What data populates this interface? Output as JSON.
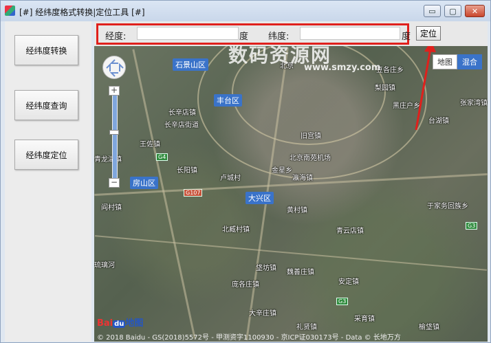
{
  "window": {
    "title": "[#] 经纬度格式转换|定位工具 [#]",
    "buttons": {
      "minimize": "▭",
      "maximize": "▢",
      "close": "✕"
    }
  },
  "sidebar": {
    "items": [
      {
        "label": "经纬度转换"
      },
      {
        "label": "经纬度查询"
      },
      {
        "label": "经纬度定位"
      }
    ]
  },
  "toolbar": {
    "longitude_label": "经度:",
    "longitude_value": "",
    "longitude_unit": "度",
    "latitude_label": "纬度:",
    "latitude_value": "",
    "latitude_unit": "度",
    "locate_button": "定位"
  },
  "map": {
    "map_type": {
      "map": "地图",
      "hybrid": "混合"
    },
    "districts": [
      "石景山区",
      "丰台区",
      "房山区",
      "大兴区"
    ],
    "places": [
      "长辛店镇",
      "长辛店街道",
      "王佐镇",
      "青龙湖镇",
      "长阳镇",
      "阎村镇",
      "卢城村",
      "金星乡",
      "瀛海镇",
      "旧宫镇",
      "北京南苑机场",
      "北臧村镇",
      "黄村镇",
      "青云店镇",
      "垡坊镇",
      "魏善庄镇",
      "庞各庄镇",
      "安定镇",
      "采育镇",
      "礼贤镇",
      "大辛庄镇",
      "榆垡镇",
      "豆各庄乡",
      "黑庄户乡",
      "台湖镇",
      "张家湾镇",
      "于家务回族乡",
      "北京",
      "琉璃河",
      "梨园镇"
    ],
    "roads": [
      "G4",
      "G107",
      "G3"
    ],
    "logo": {
      "text1": "Bai",
      "text2": "地图",
      "icon": "du"
    },
    "copyright": "© 2018 Baidu - GS(2018)5572号 - 甲测资字1100930 - 京ICP证030173号 - Data © 长地万方"
  },
  "watermark": {
    "line1": "数码资源网",
    "line2": "www.smzy.com"
  }
}
